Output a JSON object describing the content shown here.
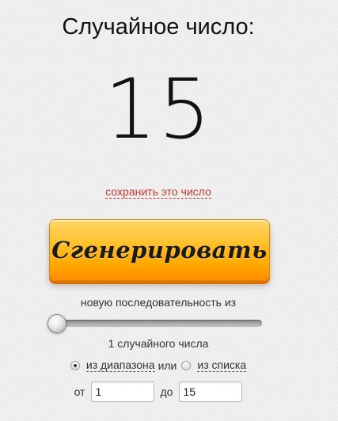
{
  "header": {
    "title": "Случайное число:"
  },
  "result": {
    "value": "15",
    "save_label": "сохранить это число"
  },
  "generate_button": {
    "label": "Сгенерировать"
  },
  "sequence": {
    "label": "новую последовательность из",
    "slider_value": 1,
    "count_label": "1 случайного числа"
  },
  "mode": {
    "selected": "range",
    "range_label": "из диапазона",
    "or_label": "или",
    "list_label": "из списка"
  },
  "range": {
    "from_label": "от",
    "from_value": "1",
    "to_label": "до",
    "to_value": "15"
  },
  "colors": {
    "accent_button": "#ffa800",
    "link": "#c0392b"
  }
}
